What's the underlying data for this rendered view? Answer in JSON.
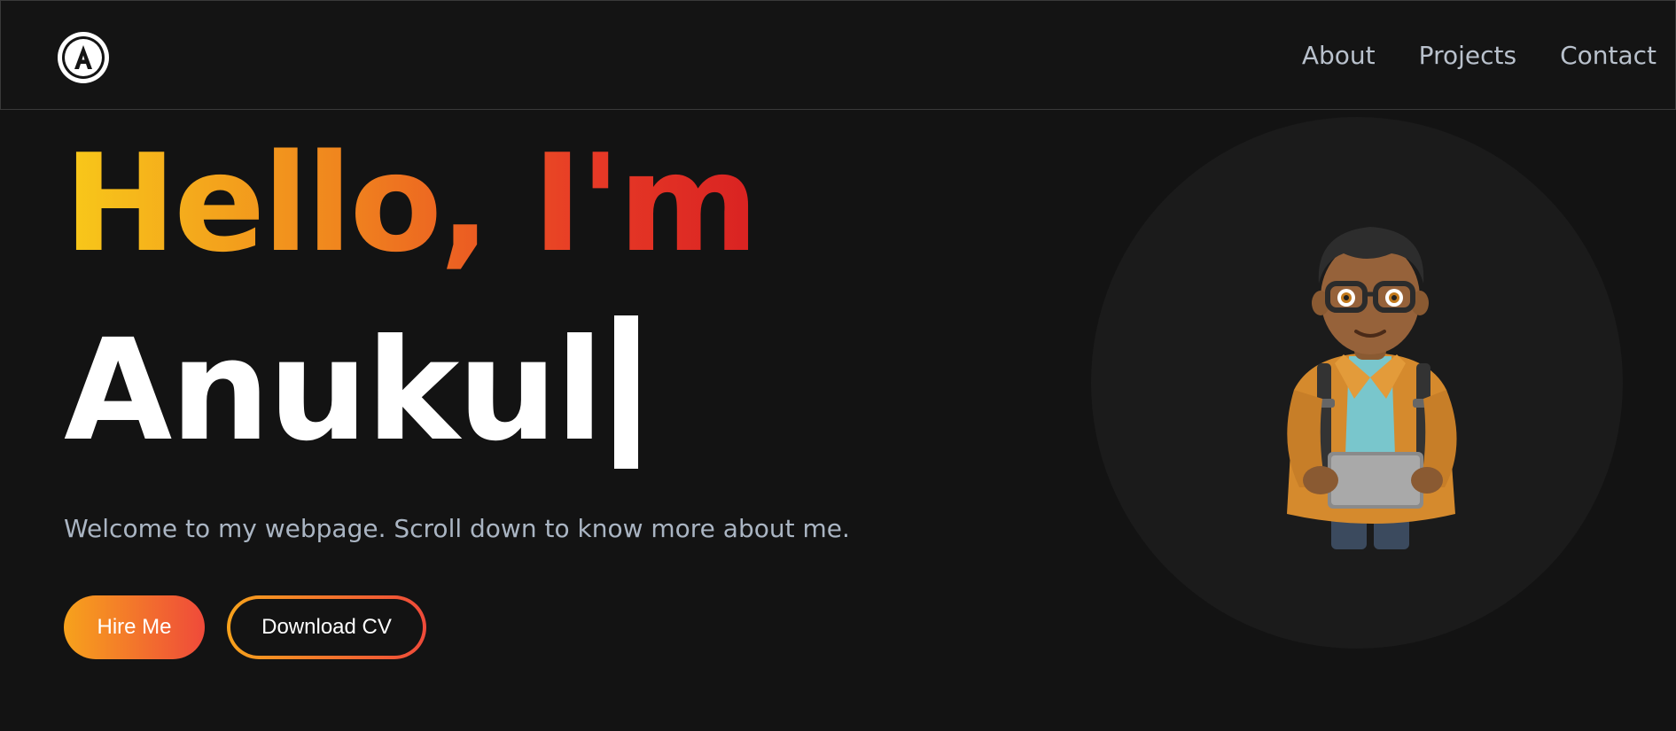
{
  "brand": {
    "logo_letter": "A",
    "logo_icon": "circled-a-logo-icon"
  },
  "nav": {
    "items": [
      {
        "label": "About"
      },
      {
        "label": "Projects"
      },
      {
        "label": "Contact"
      }
    ]
  },
  "hero": {
    "greeting": "Hello, I'm",
    "name": "Anukul",
    "tagline": "Welcome to my webpage. Scroll down to know more about me.",
    "primary_button": "Hire Me",
    "secondary_button": "Download CV",
    "avatar_icon": "developer-avatar-icon"
  },
  "colors": {
    "background": "#131313",
    "accent_start": "#f8c91a",
    "accent_mid": "#f0851e",
    "accent_end": "#d92222",
    "nav_text": "#b9c1cc",
    "tagline_text": "#aab5c3"
  }
}
